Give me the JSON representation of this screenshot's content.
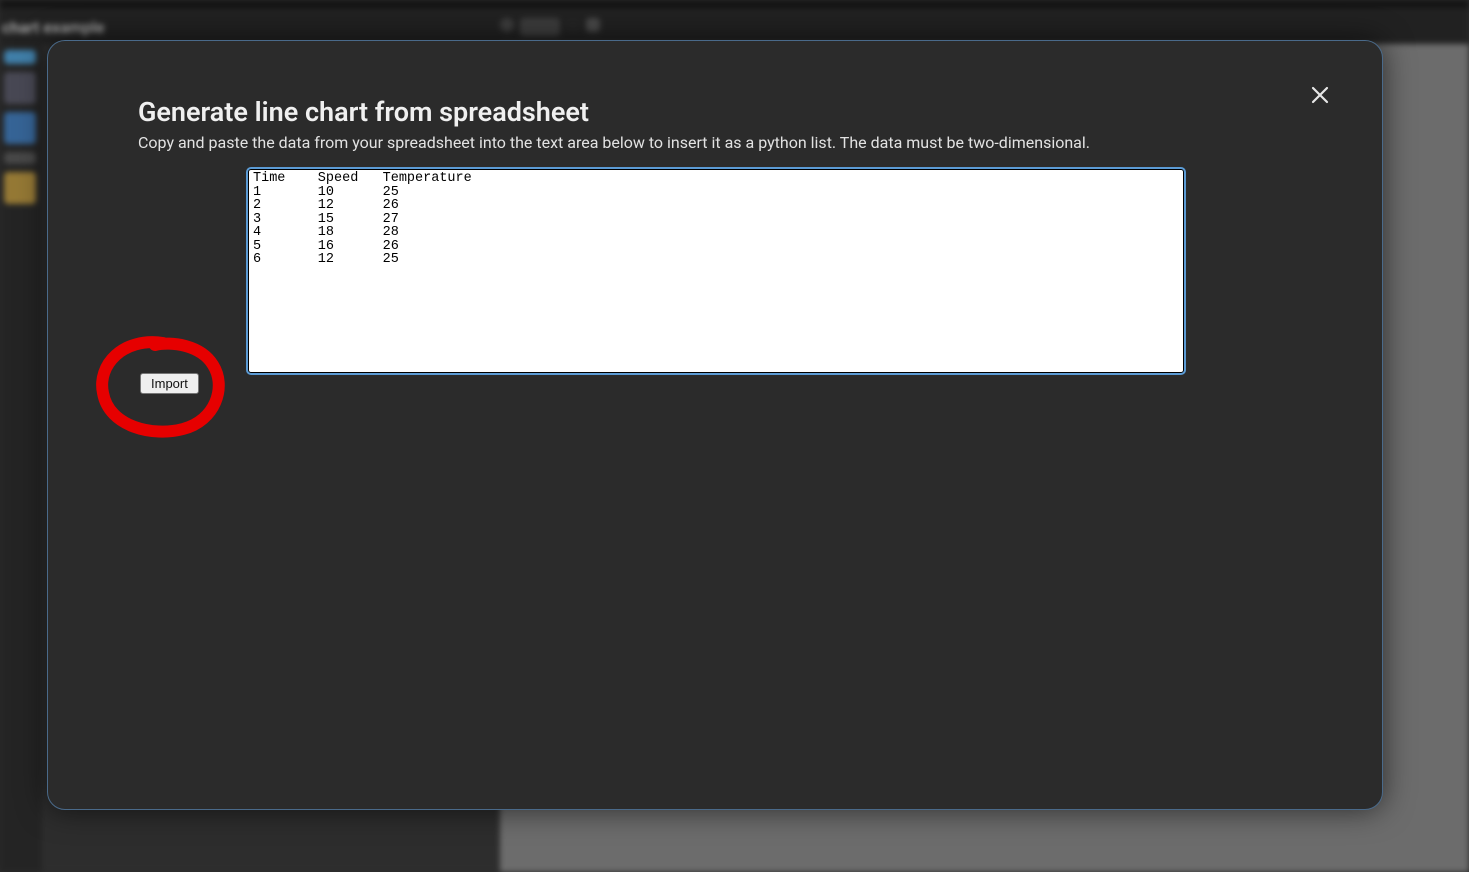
{
  "background": {
    "title": "chart example"
  },
  "modal": {
    "title": "Generate line chart from spreadsheet",
    "description": "Copy and paste the data from your spreadsheet into the text area below to insert it as a python list. The data must be two-dimensional.",
    "textarea_value": "Time    Speed   Temperature\n1       10      25\n2       12      26\n3       15      27\n4       18      28\n5       16      26\n6       12      25",
    "import_label": "Import"
  },
  "chart_data": {
    "type": "line",
    "title": "",
    "xlabel": "Time",
    "x": [
      1,
      2,
      3,
      4,
      5,
      6
    ],
    "series": [
      {
        "name": "Speed",
        "values": [
          10,
          12,
          15,
          18,
          16,
          12
        ]
      },
      {
        "name": "Temperature",
        "values": [
          25,
          26,
          27,
          28,
          26,
          25
        ]
      }
    ]
  }
}
